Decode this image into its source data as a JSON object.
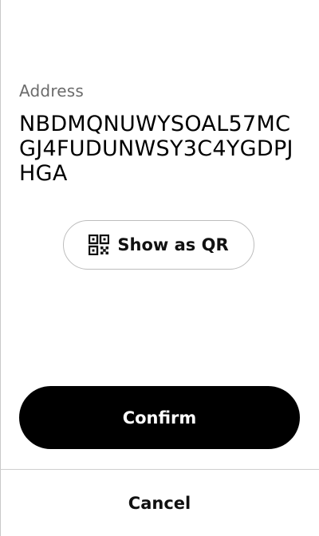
{
  "address": {
    "label": "Address",
    "value": "NBDMQNUWYSOAL57MCGJ4FUDUNWSY3C4YGDPJHGA"
  },
  "qr_button": {
    "label": "Show as QR",
    "icon": "qr-code-icon"
  },
  "actions": {
    "confirm_label": "Confirm",
    "cancel_label": "Cancel"
  },
  "colors": {
    "primary_button": "#000000",
    "primary_button_text": "#ffffff",
    "label_text": "#6b6b6b",
    "outline": "#bdbdbd"
  }
}
